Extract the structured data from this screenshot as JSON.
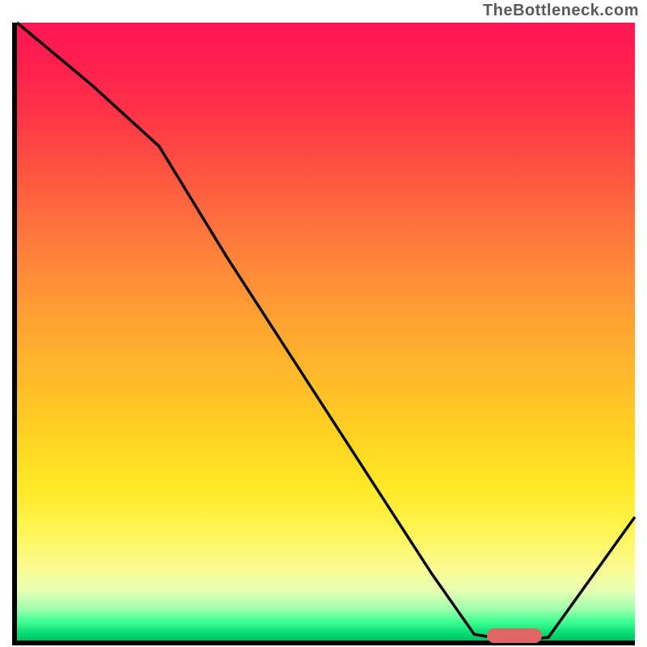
{
  "watermark": "TheBottleneck.com",
  "chart_data": {
    "type": "line",
    "title": "",
    "xlabel": "",
    "ylabel": "",
    "xlim": [
      0,
      100
    ],
    "ylim": [
      0,
      100
    ],
    "x": [
      0,
      12,
      23,
      34,
      45,
      56,
      67,
      74,
      80,
      86,
      100
    ],
    "values": [
      100,
      90,
      80,
      62,
      45,
      28,
      11,
      1,
      0,
      0.5,
      20
    ],
    "annotations": [
      {
        "label": "optimal-range",
        "x_start": 76,
        "x_end": 85,
        "y": 0
      }
    ],
    "gradient_stops": [
      {
        "pct": 0,
        "color": "#ff1754"
      },
      {
        "pct": 25,
        "color": "#ff5740"
      },
      {
        "pct": 50,
        "color": "#ffa731"
      },
      {
        "pct": 75,
        "color": "#ffe826"
      },
      {
        "pct": 92,
        "color": "#e7ffb3"
      },
      {
        "pct": 100,
        "color": "#00c063"
      }
    ]
  }
}
